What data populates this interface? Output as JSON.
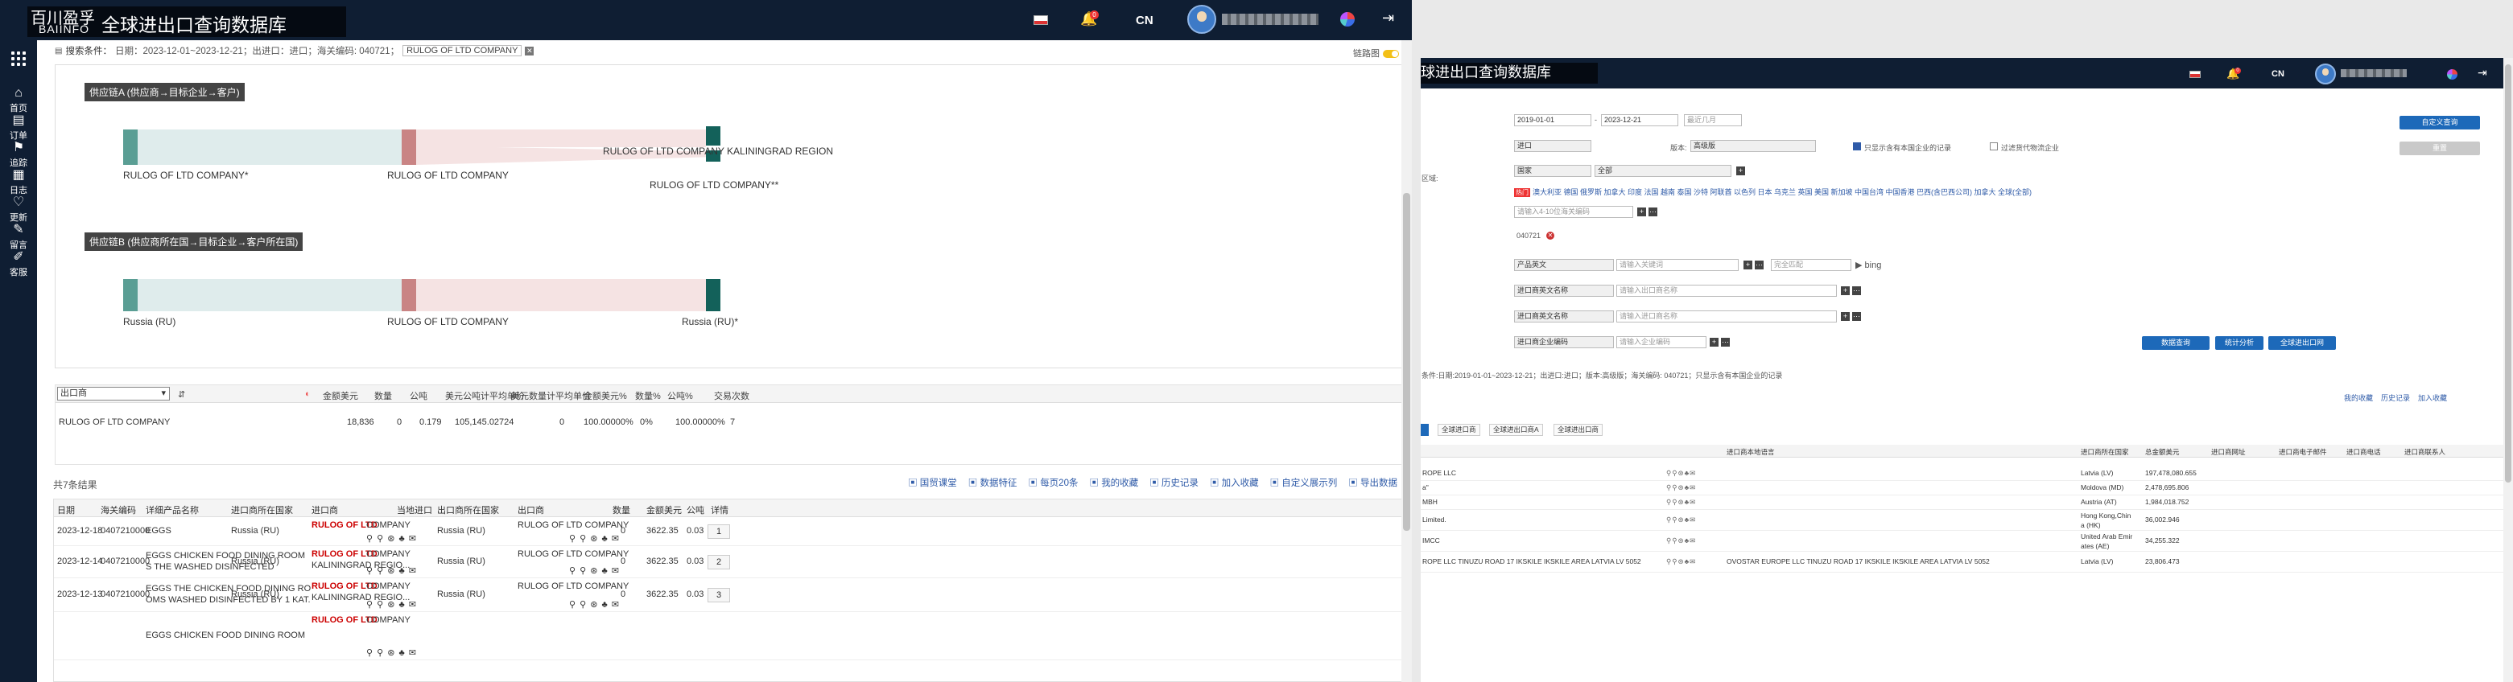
{
  "left": {
    "brand": {
      "cn": "百川盈孚",
      "en": "BAIINFO",
      "title": "全球进出口查询数据库"
    },
    "topbar": {
      "badge": "0",
      "lang": "CN"
    },
    "nav": [
      {
        "label": "首页",
        "icon": "home-icon",
        "glyph": "⌂"
      },
      {
        "label": "订单",
        "icon": "document-icon",
        "glyph": "▤"
      },
      {
        "label": "追踪",
        "icon": "bookmark-icon",
        "glyph": "⚑"
      },
      {
        "label": "日志",
        "icon": "clipboard-icon",
        "glyph": "▦"
      },
      {
        "label": "更新",
        "icon": "heart-icon",
        "glyph": "♡"
      },
      {
        "label": "留言",
        "icon": "chat-icon",
        "glyph": "✎"
      },
      {
        "label": "客服",
        "icon": "pen-icon",
        "glyph": "✐"
      }
    ],
    "criteria": {
      "label": "搜索条件：",
      "text": "日期：2023-12-01~2023-12-21；出进口：进口；海关编码: 040721；",
      "tag": "RULOG OF LTD COMPANY",
      "switch_label": "链路图"
    },
    "sankey": {
      "chainA": "供应链A (供应商→目标企业→客户)",
      "chainB": "供应链B (供应商所在国→目标企业→客户所在国)",
      "a_left": "RULOG OF LTD COMPANY*",
      "a_mid": "RULOG OF LTD COMPANY",
      "a_right1": "RULOG OF LTD COMPANY KALININGRAD REGION",
      "a_right2": "RULOG OF LTD COMPANY**",
      "b_left": "Russia (RU)",
      "b_mid": "RULOG OF LTD COMPANY",
      "b_right": "Russia (RU)*"
    },
    "agg": {
      "select": "出口商",
      "headers": [
        "金额美元",
        "数量",
        "公吨",
        "美元公吨计平均单价",
        "美元数量计平均单价",
        "金额美元%",
        "数量%",
        "公吨%",
        "交易次数"
      ],
      "row": {
        "name": "RULOG OF LTD COMPANY",
        "values": [
          "18,836",
          "0",
          "0.179",
          "105,145.02724",
          "0",
          "100.00000%",
          "0%",
          "100.00000%",
          "7"
        ]
      }
    },
    "total": "共7条结果",
    "tools": [
      "国贸课堂",
      "数据特征",
      "每页20条",
      "我的收藏",
      "历史记录",
      "加入收藏",
      "自定义展示列",
      "导出数据"
    ],
    "table": {
      "headers": [
        "日期",
        "海关编码",
        "详细产品名称",
        "进口商所在国家",
        "进口商",
        "当地进口",
        "出口商所在国家",
        "出口商",
        "数量",
        "金额美元",
        "公吨",
        "详情"
      ],
      "rows": [
        {
          "date": "2023-12-18",
          "hs": "0407210000",
          "product1": "EGGS",
          "product2": "",
          "country": "Russia (RU)",
          "importer_red": "RULOG OF LTD",
          "importer_rest": "COMPANY",
          "importer2": "",
          "ex_country": "Russia (RU)",
          "exporter": "RULOG OF LTD COMPANY",
          "qty": "0",
          "usd": "3622.35",
          "ton": "0.03",
          "detail": "1"
        },
        {
          "date": "2023-12-14",
          "hs": "0407210000",
          "product1": "EGGS CHICKEN FOOD DINING ROOM",
          "product2": "S THE WASHED DISINFECTED",
          "country": "Russia (RU)",
          "importer_red": "RULOG OF LTD",
          "importer_rest": "COMPANY",
          "importer2": "KALININGRAD REGIO...",
          "ex_country": "Russia (RU)",
          "exporter": "RULOG OF LTD COMPANY",
          "qty": "0",
          "usd": "3622.35",
          "ton": "0.03",
          "detail": "2"
        },
        {
          "date": "2023-12-13",
          "hs": "0407210000",
          "product1": "EGGS THE CHICKEN FOOD DINING RO",
          "product2": "OMS WASHED DISINFECTED BY 1 KAT.",
          "country": "Russia (RU)",
          "importer_red": "RULOG OF LTD",
          "importer_rest": "COMPANY",
          "importer2": "KALININGRAD REGIO...",
          "ex_country": "Russia (RU)",
          "exporter": "RULOG OF LTD COMPANY",
          "qty": "0",
          "usd": "3622.35",
          "ton": "0.03",
          "detail": "3"
        },
        {
          "date": "",
          "hs": "",
          "product1": "EGGS CHICKEN FOOD DINING ROOM",
          "product2": "",
          "country": "",
          "importer_red": "RULOG OF LTD",
          "importer_rest": "COMPANY",
          "importer2": "",
          "ex_country": "",
          "exporter": "",
          "qty": "",
          "usd": "",
          "ton": "",
          "detail": ""
        }
      ]
    }
  },
  "right": {
    "title": "球进出口查询数据库",
    "topbar": {
      "badge": "0",
      "lang": "CN"
    },
    "form": {
      "date_from": "2019-01-01",
      "date_to": "2023-12-21",
      "recent": "最近几月",
      "ie": "进口",
      "version_label": "版本:",
      "version": "高级版",
      "only_label": "只显示含有本国企业的记录",
      "filter_label": "过滤货代物流企业",
      "region_label": "区域:",
      "region_type": "国家",
      "region_value": "全部",
      "hot": "热门",
      "countries": "澳大利亚 德国 俄罗斯 加拿大 印度 法国 越南 泰国 沙特 阿联酋 以色列 日本 乌克兰 英国 美国 新加坡 中国台湾 中国香港 巴西(含巴西公司) 加拿大 全球(全部)",
      "hs_placeholder": "请输入4-10位海关编码",
      "hs_tag": "040721",
      "product_label": "产品英文",
      "product_ph": "请输入关键词",
      "match": "完全匹配",
      "bing": "bing",
      "exporter_label": "进口商英文名称",
      "exporter_ph": "请输入出口商名称",
      "importer_label": "进口商英文名称",
      "importer_ph": "请输入进口商名称",
      "code_label": "进口商企业编码",
      "code_ph": "请输入企业编码",
      "btn_custom": "自定义查询",
      "btn_reset": "重置",
      "btn_query": "数据查询",
      "btn_stat": "统计分析",
      "btn_export": "全球进出口网"
    },
    "criteria": "条件:日期:2019-01-01~2023-12-21；出进口:进口；版本:高级版；海关编码: 040721；只显示含有本国企业的记录",
    "tools": [
      "我的收藏",
      "历史记录",
      "加入收藏"
    ],
    "tabs": [
      "全球进口商",
      "全球进出口商A",
      "全球进出口商"
    ],
    "table": {
      "headers": [
        "进口商本地语言",
        "进口商所在国家",
        "总金额美元",
        "进口商网址",
        "进口商电子邮件",
        "进口商电话",
        "进口商联系人"
      ],
      "rows": [
        {
          "name": "ROPE LLC",
          "local": "",
          "country": "Latvia (LV)",
          "country2": "",
          "usd": "197,478,080.655"
        },
        {
          "name": "a\"",
          "local": "",
          "country": "Moldova (MD)",
          "country2": "",
          "usd": "2,478,695.806"
        },
        {
          "name": "MBH",
          "local": "",
          "country": "Austria (AT)",
          "country2": "",
          "usd": "1,984,018.752"
        },
        {
          "name": "Limited.",
          "local": "",
          "country": "Hong Kong,Chin",
          "country2": "a (HK)",
          "usd": "36,002.946"
        },
        {
          "name": "IMCC",
          "local": "",
          "country": "United Arab Emir",
          "country2": "ates (AE)",
          "usd": "34,255.322"
        },
        {
          "name": "ROPE LLC TINUZU ROAD 17 IKSKILE IKSKILE AREA LATVIA LV 5052",
          "local": "OVOSTAR EUROPE LLC TINUZU ROAD 17 IKSKILE IKSKILE AREA LATVIA LV 5052",
          "country": "Latvia (LV)",
          "country2": "",
          "usd": "23,806.473"
        }
      ]
    }
  },
  "colors": {
    "nav": "#0f1e33",
    "teal": "#5a9e94",
    "rose": "#c98484",
    "dark_teal": "#13615a",
    "blue": "#2f5ba8",
    "red": "#cc0000"
  }
}
